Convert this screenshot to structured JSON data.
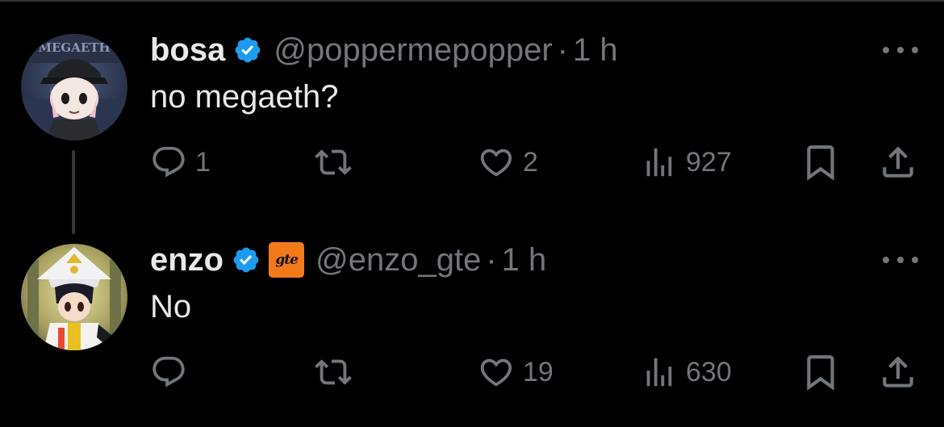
{
  "colors": {
    "background": "#000000",
    "primary_text": "#e7e9ea",
    "secondary_text": "#71767b",
    "verified_blue": "#1d9bf0",
    "affiliate_orange": "#f27a1a",
    "thread_line": "#333639"
  },
  "tweets": [
    {
      "display_name": "bosa",
      "verified": true,
      "handle": "@poppermepopper",
      "separator": "·",
      "time": "1 h",
      "text": "no megaeth?",
      "avatar_icon": "anime-avatar-cap-icon",
      "avatar_cap_text": "MEGAETH",
      "actions": {
        "replies": "1",
        "retweets": "",
        "likes": "2",
        "views": "927"
      }
    },
    {
      "display_name": "enzo",
      "verified": true,
      "affiliate_badge_text": "gte",
      "handle": "@enzo_gte",
      "separator": "·",
      "time": "1 h",
      "text": "No",
      "avatar_icon": "anime-avatar-wizard-icon",
      "actions": {
        "replies": "",
        "retweets": "",
        "likes": "19",
        "views": "630"
      }
    }
  ],
  "icons": {
    "reply": "reply-icon",
    "retweet": "retweet-icon",
    "like": "heart-icon",
    "views": "views-chart-icon",
    "bookmark": "bookmark-icon",
    "share": "share-icon",
    "more": "more-dots-icon",
    "verified": "verified-badge-icon"
  }
}
